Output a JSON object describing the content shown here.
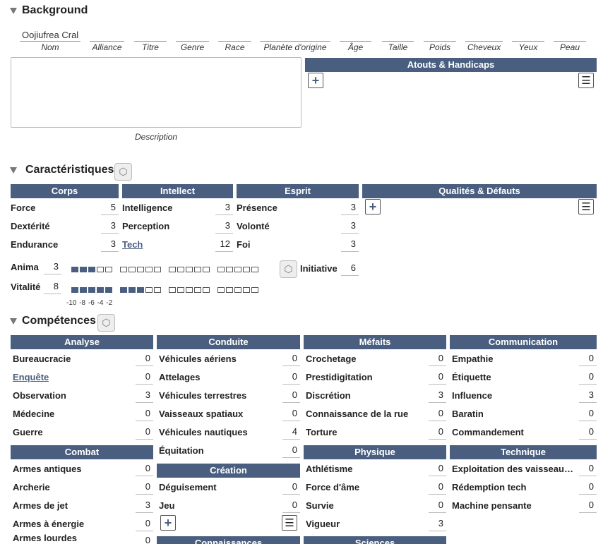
{
  "sections": {
    "background": "Background",
    "caracteristiques": "Caractéristiques",
    "competences": "Compétences"
  },
  "background": {
    "name_value": "Oojiufrea Cral",
    "field_labels": [
      "Nom",
      "Alliance",
      "Titre",
      "Genre",
      "Race",
      "Planète d'origine",
      "Âge",
      "Taille",
      "Poids",
      "Cheveux",
      "Yeux",
      "Peau"
    ],
    "description_label": "Description",
    "atouts_header": "Atouts & Handicaps"
  },
  "carac": {
    "headers": [
      "Corps",
      "Intellect",
      "Esprit",
      "Qualités & Défauts"
    ],
    "corps": [
      {
        "label": "Force",
        "value": "5"
      },
      {
        "label": "Dextérité",
        "value": "3"
      },
      {
        "label": "Endurance",
        "value": "3"
      }
    ],
    "intellect": [
      {
        "label": "Intelligence",
        "value": "3"
      },
      {
        "label": "Perception",
        "value": "3"
      },
      {
        "label": "Tech",
        "value": "12"
      }
    ],
    "esprit": [
      {
        "label": "Présence",
        "value": "3"
      },
      {
        "label": "Volonté",
        "value": "3"
      },
      {
        "label": "Foi",
        "value": "3"
      }
    ],
    "anima_label": "Anima",
    "anima_value": "3",
    "vitalite_label": "Vitalité",
    "vitalite_value": "8",
    "initiative_label": "Initiative",
    "initiative_value": "6",
    "scale": "-10 -8 -6 -4 -2"
  },
  "comp": {
    "analyse": {
      "title": "Analyse",
      "items": [
        [
          "Bureaucracie",
          "0"
        ],
        [
          "Enquête",
          "0"
        ],
        [
          "Observation",
          "3"
        ],
        [
          "Médecine",
          "0"
        ],
        [
          "Guerre",
          "0"
        ]
      ]
    },
    "conduite": {
      "title": "Conduite",
      "items": [
        [
          "Véhicules aériens",
          "0"
        ],
        [
          "Attelages",
          "0"
        ],
        [
          "Véhicules terrestres",
          "0"
        ],
        [
          "Vaisseaux spatiaux",
          "0"
        ],
        [
          "Véhicules nautiques",
          "4"
        ],
        [
          "Équitation",
          "0"
        ]
      ]
    },
    "mefaits": {
      "title": "Méfaits",
      "items": [
        [
          "Crochetage",
          "0"
        ],
        [
          "Prestidigitation",
          "0"
        ],
        [
          "Discrétion",
          "3"
        ],
        [
          "Connaissance de la rue",
          "0"
        ],
        [
          "Torture",
          "0"
        ]
      ]
    },
    "communication": {
      "title": "Communication",
      "items": [
        [
          "Empathie",
          "0"
        ],
        [
          "Étiquette",
          "0"
        ],
        [
          "Influence",
          "3"
        ],
        [
          "Baratin",
          "0"
        ],
        [
          "Commandement",
          "0"
        ]
      ]
    },
    "combat": {
      "title": "Combat",
      "items": [
        [
          "Armes antiques",
          "0"
        ],
        [
          "Archerie",
          "0"
        ],
        [
          "Armes de jet",
          "3"
        ],
        [
          "Armes à énergie",
          "0"
        ],
        [
          "Armes lourdes",
          "0"
        ]
      ]
    },
    "creation": {
      "title": "Création",
      "items": [
        [
          "Déguisement",
          "0"
        ],
        [
          "Jeu",
          "0"
        ]
      ]
    },
    "physique": {
      "title": "Physique",
      "items": [
        [
          "Athlétisme",
          "0"
        ],
        [
          "Force d'âme",
          "0"
        ],
        [
          "Survie",
          "0"
        ],
        [
          "Vigueur",
          "3"
        ]
      ]
    },
    "technique": {
      "title": "Technique",
      "items": [
        [
          "Exploitation des vaisseau…",
          "0"
        ],
        [
          "Rédemption tech",
          "0"
        ],
        [
          "Machine pensante",
          "0"
        ]
      ]
    },
    "connaissances": {
      "title": "Connaissances"
    },
    "sciences": {
      "title": "Sciences"
    }
  },
  "colors": {
    "header": "#4a5f80"
  }
}
